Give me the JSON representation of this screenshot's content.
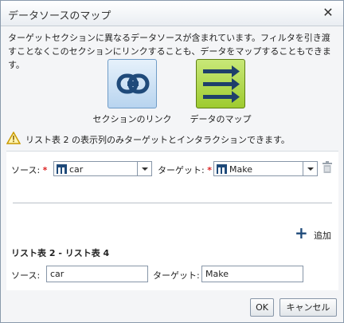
{
  "dialog": {
    "title": "データソースのマップ",
    "description": "ターゲットセクションに異なるデータソースが含まれています。フィルタを引き渡すことなくこのセクションにリンクすることも、データをマップすることもできます。"
  },
  "options": [
    {
      "label": "セクションのリンク",
      "icon": "link-icon"
    },
    {
      "label": "データのマップ",
      "icon": "arrows-icon"
    }
  ],
  "warning": {
    "icon": "warning-icon",
    "text": "リスト表 2 の表示列のみターゲットとインタラクションできます。"
  },
  "mapping": {
    "source_label": "ソース:",
    "source_value": "car",
    "target_label": "ターゲット:",
    "target_value": "Make",
    "required_marker": "*"
  },
  "add_label": "追加",
  "summary": {
    "title": "リスト表 2 - リスト表 4",
    "source_label": "ソース:",
    "source_value": "car",
    "target_label": "ターゲット:",
    "target_value": "Make"
  },
  "buttons": {
    "ok": "OK",
    "cancel": "キャンセル"
  },
  "colors": {
    "link_tile": "#b8d4ef",
    "map_tile": "#9ecb2f",
    "required": "#dd2222",
    "accent": "#1f4a7a"
  }
}
